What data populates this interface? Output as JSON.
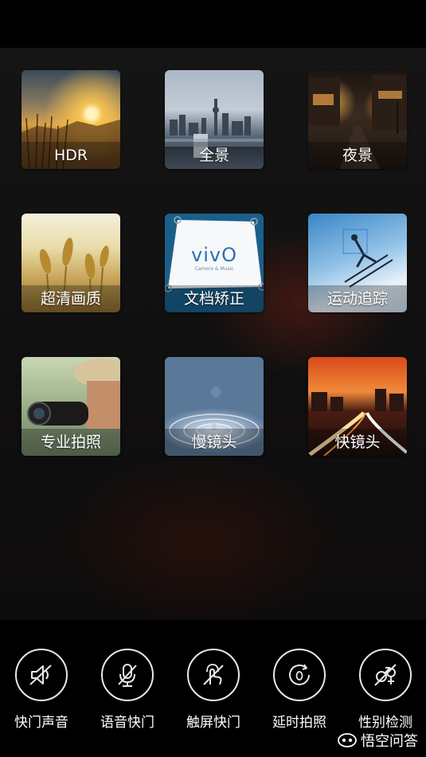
{
  "modes": [
    {
      "id": "hdr",
      "label": "HDR"
    },
    {
      "id": "panorama",
      "label": "全景"
    },
    {
      "id": "night",
      "label": "夜景"
    },
    {
      "id": "ultra-hd",
      "label": "超清画质"
    },
    {
      "id": "doc-correct",
      "label": "文档矫正"
    },
    {
      "id": "motion-track",
      "label": "运动追踪"
    },
    {
      "id": "pro-photo",
      "label": "专业拍照"
    },
    {
      "id": "slow-motion",
      "label": "慢镜头"
    },
    {
      "id": "fast-motion",
      "label": "快镜头"
    }
  ],
  "doc_tile": {
    "logo": "vivO",
    "tagline": "Camera & Music"
  },
  "options": [
    {
      "id": "shutter-sound",
      "label": "快门声音",
      "icon": "speaker-muted-icon"
    },
    {
      "id": "voice-shutter",
      "label": "语音快门",
      "icon": "microphone-off-icon"
    },
    {
      "id": "touch-shutter",
      "label": "触屏快门",
      "icon": "touch-off-icon"
    },
    {
      "id": "timer",
      "label": "延时拍照",
      "icon": "timer-icon"
    },
    {
      "id": "gender-detect",
      "label": "性别检测",
      "icon": "gender-off-icon"
    }
  ],
  "watermark": {
    "text": "悟空问答"
  },
  "colors": {
    "background": "#000000",
    "icon_stroke": "#e8e8e8",
    "doc_tile_blue": "#1a5f8a"
  }
}
